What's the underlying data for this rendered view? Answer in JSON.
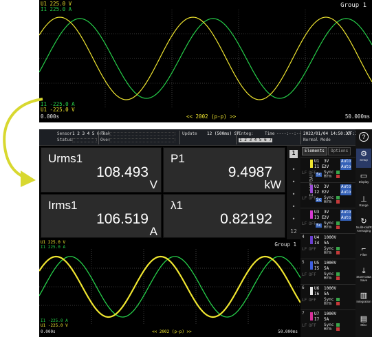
{
  "top_scope": {
    "ch_u1_top": "U1  225.0 V",
    "ch_i1_top": "I1  225.0 A",
    "group": "Group  1",
    "ch_i1_bot": "I1  -225.0 A",
    "ch_u1_bot": "U1  -225.0 V",
    "time_start": "0.000s",
    "time_end": "50.000ms",
    "scale": "<< 2002 (p-p) >>"
  },
  "status": {
    "sensor_label": "Sensor",
    "sensor_val": "1 2 3 4 5 6 7",
    "status_label": "Status",
    "peak_label": "Peak",
    "over_label": "Over",
    "update_label": "Update",
    "update_val": "12 (500ms) SP",
    "integ_label": "Integ:",
    "integ_val": "1 2 3 4 5 6 7",
    "time_label": "Time",
    "time_val": "----:--:--",
    "datetime": "2022/01/04  14:50:37",
    "mode": "Normal Mode",
    "cf": "CF:3",
    "help": "?"
  },
  "values": [
    {
      "name": "Urms1",
      "value": "108.493",
      "unit": "V"
    },
    {
      "name": "P1",
      "value": "9.4987",
      "unit": "kW"
    },
    {
      "name": "Irms1",
      "value": "106.519",
      "unit": "A"
    },
    {
      "name": "λ1",
      "value": "0.82192",
      "unit": ""
    }
  ],
  "pager": {
    "current": "1",
    "last": "12"
  },
  "bottom_scope": {
    "ch_u1_top": "U1  225.0 V",
    "ch_i1_top": "I1  225.0 A",
    "group": "Group  1",
    "ch_i1_bot": "I1  -225.0 A",
    "ch_u1_bot": "U1  -225.0 V",
    "time_start": "0.000s",
    "time_end": "50.000ms",
    "scale": "<< 2002 (p-p) >>"
  },
  "elements_panel": {
    "tab_elements": "Elements",
    "tab_options": "Options",
    "sigma_label": "Σ A(3V3A)",
    "rows": [
      {
        "num": "",
        "u": "U1",
        "urange": "3V",
        "i": "I1 E",
        "irange": "2V",
        "auto": "Auto",
        "color": "#f0e630"
      },
      {
        "num": "",
        "u": "U2",
        "urange": "3V",
        "i": "I2 E",
        "irange": "2V",
        "auto": "Auto",
        "color": "#9b4dd6"
      },
      {
        "num": "",
        "u": "U3",
        "urange": "3V",
        "i": "I3 E",
        "irange": "2V",
        "auto": "Auto",
        "color": "#d63ad0"
      },
      {
        "num": "4",
        "u": "U4",
        "urange": "1000V",
        "i": "I4",
        "irange": "5A",
        "auto": "",
        "color": "#6a3fd0"
      },
      {
        "num": "5",
        "u": "U5",
        "urange": "1000V",
        "i": "I5",
        "irange": "5A",
        "auto": "",
        "color": "#3f60e0"
      },
      {
        "num": "6",
        "u": "U6",
        "urange": "1000V",
        "i": "I6",
        "irange": "5A",
        "auto": "",
        "color": "#e8e8e8"
      },
      {
        "num": "7",
        "u": "U7",
        "urange": "1000V",
        "i": "I7",
        "irange": "5A",
        "auto": "",
        "color": "#d6309a"
      }
    ],
    "sync_label": "Sync",
    "hrm_label": "Hrm",
    "sc_label": "Sc",
    "lf_label": "LF",
    "off_label": "OFF"
  },
  "right_bar": [
    {
      "label": "Setup",
      "icon": "gear-icon"
    },
    {
      "label": "Display",
      "icon": "display-icon"
    },
    {
      "label": "Range",
      "icon": "range-icon"
    },
    {
      "label": "Null/Hold/Rate Averaging",
      "icon": "refresh-icon"
    },
    {
      "label": "Filter",
      "icon": "filter-icon"
    },
    {
      "label": "Store Data Save",
      "icon": "store-icon"
    },
    {
      "label": "Integration",
      "icon": "integration-icon"
    },
    {
      "label": "Misc",
      "icon": "toolbox-icon"
    }
  ],
  "colors": {
    "voltage": "#f0e630",
    "current": "#26d04a",
    "arrow": "#d8d830"
  }
}
